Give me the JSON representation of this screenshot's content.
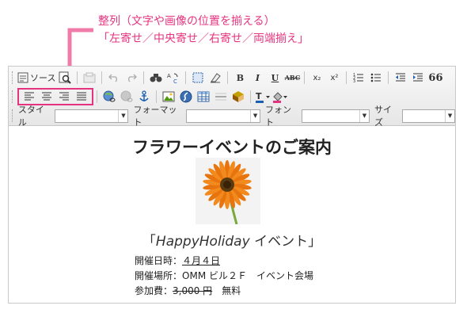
{
  "annotation": {
    "line1": "整列（文字や画像の位置を揃える）",
    "line2": "「左寄せ／中央寄せ／右寄せ／両端揃え」",
    "color": "#e5337f"
  },
  "toolbar": {
    "source_label": "ソース",
    "style_label": "スタイル",
    "format_label": "フォーマット",
    "font_label": "フォント",
    "size_label": "サイズ",
    "bold": "B",
    "italic": "I",
    "underline": "U",
    "strike": "ABC",
    "subscript": "x₂",
    "superscript": "x²",
    "blockquote": "66"
  },
  "content": {
    "title": "フラワーイベントのご案内",
    "event_open": "「",
    "event_ital": "HappyHoliday",
    "event_rest": " イベント」",
    "date_label": "開催日時：",
    "date_value": "４月４日",
    "place_label": "開催場所：",
    "place_value": "OMM ビル２Ｆ　イベント会場",
    "fee_label": "参加費：",
    "fee_old": "3,000 円",
    "fee_new": "　無料"
  }
}
